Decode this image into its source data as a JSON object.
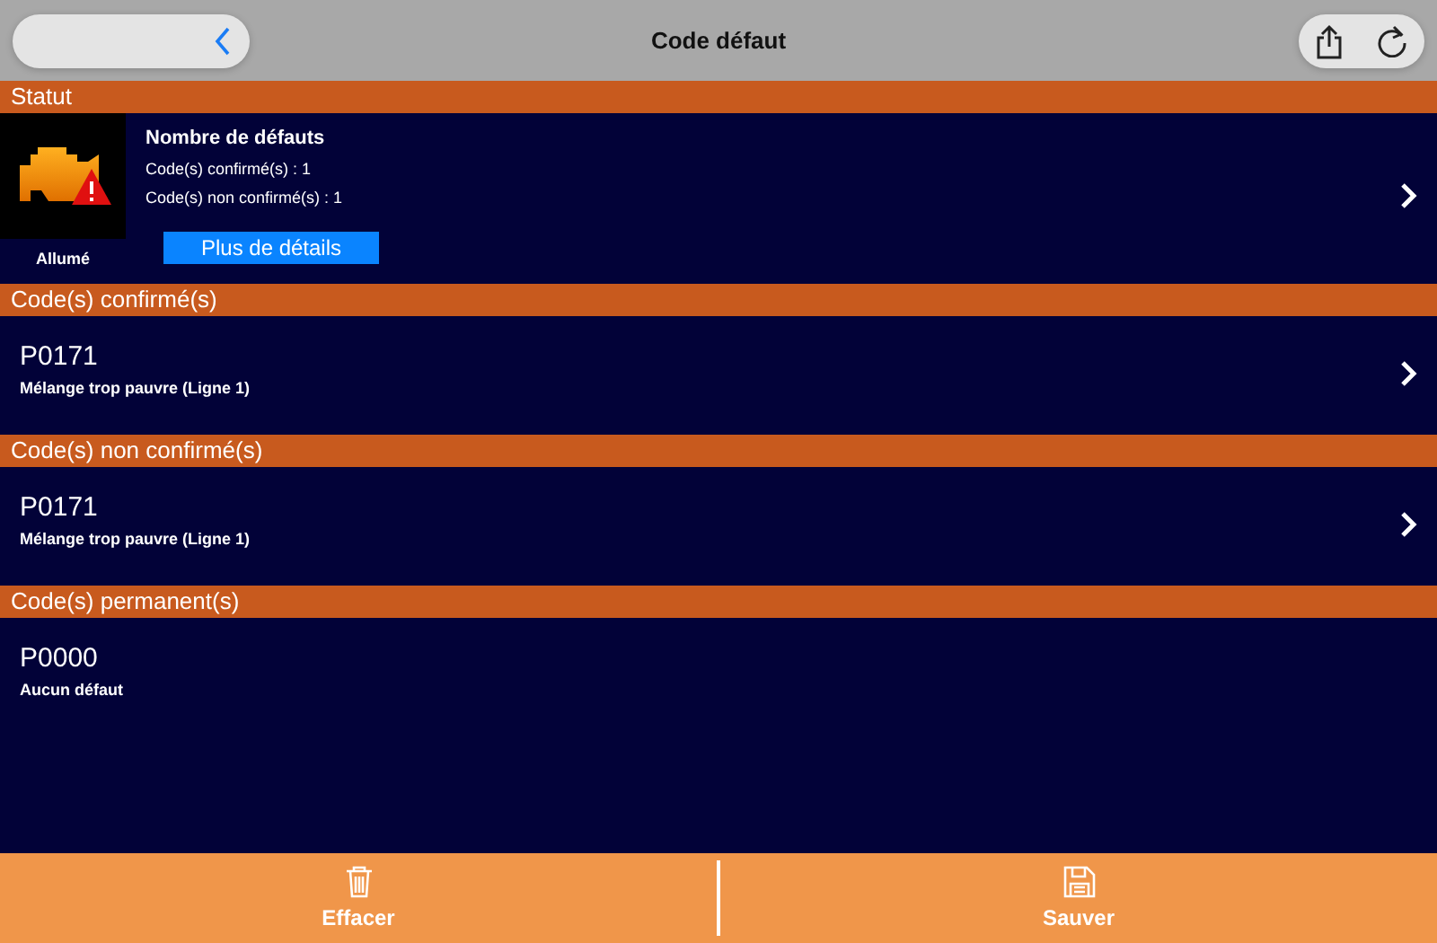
{
  "window": {
    "title": "Code défaut"
  },
  "status": {
    "header": "Statut",
    "lamp_label": "Allumé",
    "heading": "Nombre de défauts",
    "lines": [
      "Code(s) confirmé(s) : 1",
      "Code(s) non confirmé(s) : 1"
    ],
    "button": "Plus de détails",
    "expandable": true
  },
  "sections": [
    {
      "header": "Code(s) confirmé(s)",
      "code": "P0171",
      "description": "Mélange trop pauvre (Ligne 1)",
      "expandable": true
    },
    {
      "header": "Code(s) non confirmé(s)",
      "code": "P0171",
      "description": "Mélange trop pauvre (Ligne 1)",
      "expandable": true
    },
    {
      "header": "Code(s) permanent(s)",
      "code": "P0000",
      "description": "Aucun défaut",
      "expandable": false
    }
  ],
  "footer": [
    {
      "kind": "trash",
      "label": "Effacer"
    },
    {
      "kind": "save",
      "label": "Sauver"
    }
  ]
}
